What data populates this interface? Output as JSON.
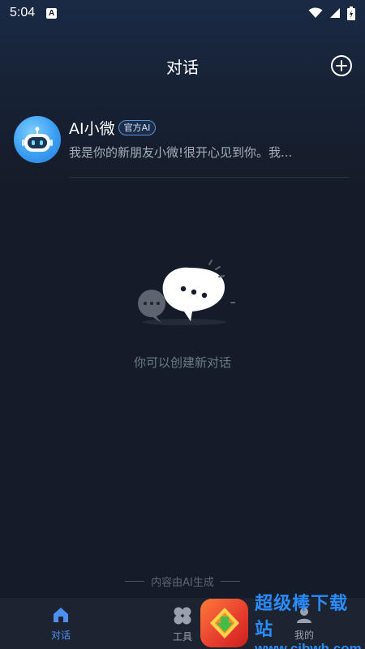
{
  "status_bar": {
    "time": "5:04",
    "notification_letter": "A"
  },
  "header": {
    "title": "对话",
    "add_icon": "plus-circle-icon"
  },
  "chat_list": [
    {
      "name": "AI小微",
      "badge": "官方AI",
      "preview": "我是你的新朋友小微!很开心见到你。我...",
      "avatar_icon": "robot-icon"
    }
  ],
  "empty_state": {
    "text": "你可以创建新对话",
    "icon": "chat-bubbles-icon"
  },
  "footer_note": "内容由AI生成",
  "tabs": [
    {
      "label": "对话",
      "icon": "home-icon",
      "active": true
    },
    {
      "label": "工具",
      "icon": "grid-icon",
      "active": false
    },
    {
      "label": "我的",
      "icon": "user-icon",
      "active": false
    }
  ],
  "watermark": {
    "title": "超级棒下载站",
    "url": "www.cjbwh.com"
  },
  "colors": {
    "background": "#151c29",
    "accent": "#4e8ff2",
    "tab_bar": "#1d2431"
  }
}
